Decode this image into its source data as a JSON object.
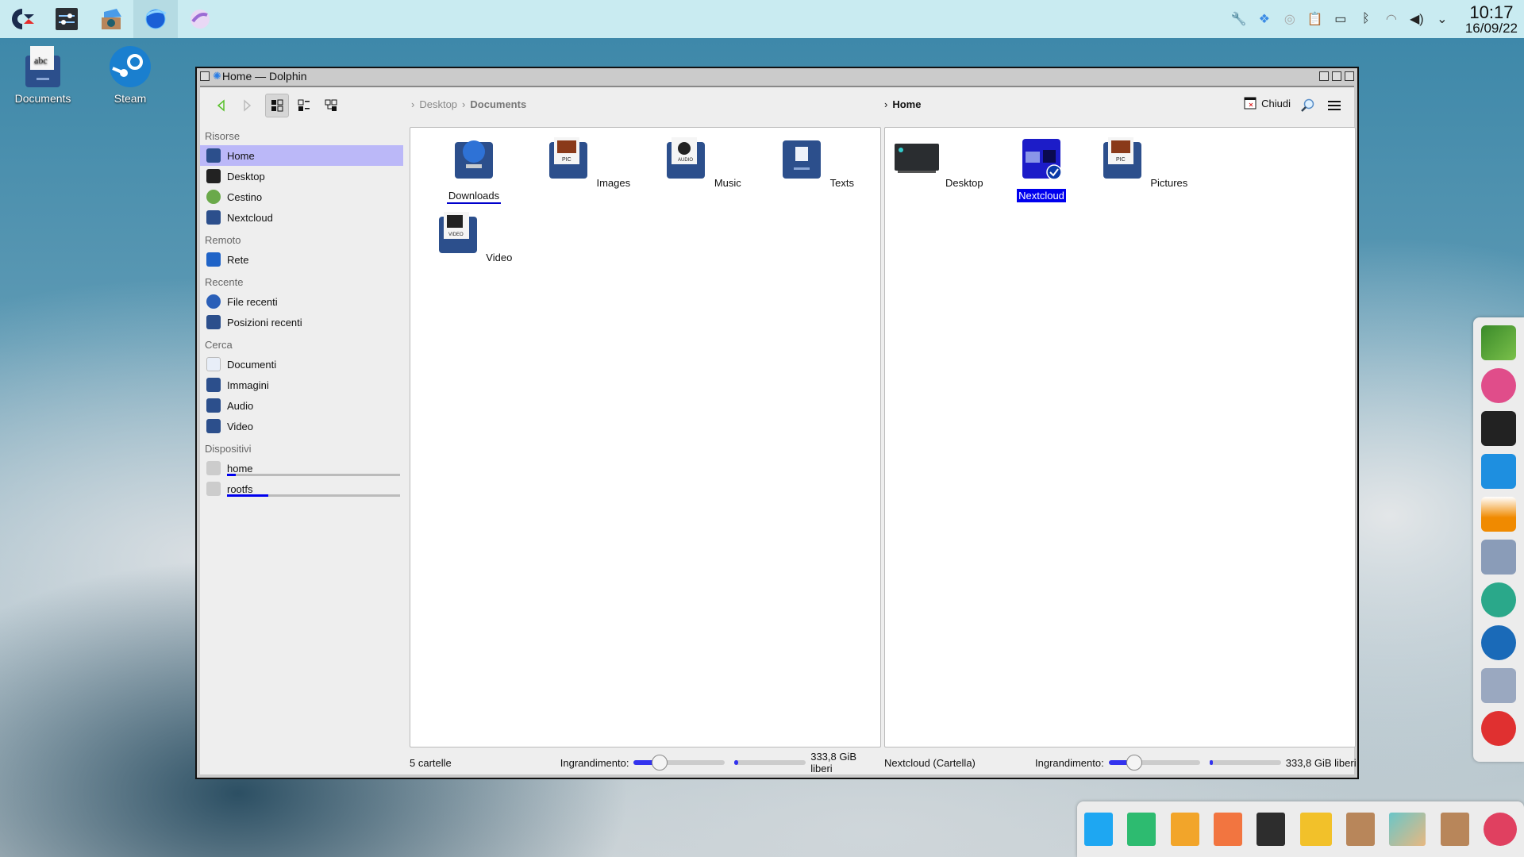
{
  "top_panel": {
    "launchers": [
      {
        "name": "commodore-logo",
        "label": "C="
      },
      {
        "name": "settings-sliders"
      },
      {
        "name": "software-center"
      },
      {
        "name": "dolphin-browser"
      },
      {
        "name": "eye-of-gnome"
      }
    ],
    "tray": [
      "tools",
      "dropbox",
      "steam",
      "clipboard",
      "battery",
      "bluetooth",
      "wifi",
      "volume",
      "expand"
    ],
    "clock": {
      "time": "10:17",
      "date": "16/09/22"
    }
  },
  "desktop": {
    "icons": [
      {
        "label": "Documents"
      },
      {
        "label": "Steam"
      }
    ]
  },
  "window": {
    "title": "Home — Dolphin",
    "toolbar": {
      "close_label": "Chiudi"
    },
    "left_breadcrumb": [
      "Desktop",
      "Documents"
    ],
    "right_breadcrumb": [
      "Home"
    ],
    "sidebar": {
      "sections": [
        {
          "title": "Risorse",
          "items": [
            "Home",
            "Desktop",
            "Cestino",
            "Nextcloud"
          ]
        },
        {
          "title": "Remoto",
          "items": [
            "Rete"
          ]
        },
        {
          "title": "Recente",
          "items": [
            "File recenti",
            "Posizioni recenti"
          ]
        },
        {
          "title": "Cerca",
          "items": [
            "Documenti",
            "Immagini",
            "Audio",
            "Video"
          ]
        },
        {
          "title": "Dispositivi",
          "devices": [
            {
              "label": "home",
              "usage": 0.05
            },
            {
              "label": "rootfs",
              "usage": 0.24
            }
          ]
        }
      ],
      "selected": "Home"
    },
    "left_pane": {
      "items": [
        "Downloads",
        "Images",
        "Music",
        "Texts",
        "Video"
      ],
      "hovered": "Downloads",
      "status": "5 cartelle",
      "zoom_label": "Ingrandimento:",
      "zoom_level": 0.28,
      "space_free": "333,8 GiB liberi",
      "space_used": 0.05
    },
    "right_pane": {
      "items": [
        "Desktop",
        "Nextcloud",
        "Pictures"
      ],
      "selected": "Nextcloud",
      "status": "Nextcloud (Cartella)",
      "zoom_label": "Ingrandimento:",
      "zoom_level": 0.28,
      "space_free": "333,8 GiB liberi",
      "space_used": 0.05
    }
  },
  "right_dock": [
    "notebook",
    "image-viewer",
    "calibre",
    "kdeconnect",
    "vlc",
    "calculator",
    "app-ring",
    "webcam",
    "shell",
    "help"
  ],
  "bottom_dock": [
    "writer",
    "calc",
    "draw",
    "impress",
    "template",
    "notes",
    "software-center",
    "screenshot",
    "package-installer",
    "game"
  ],
  "colors": {
    "selection": "#0000ee",
    "sidebar_selected": "#bbb8f8",
    "panel": "#c9ebf1"
  }
}
